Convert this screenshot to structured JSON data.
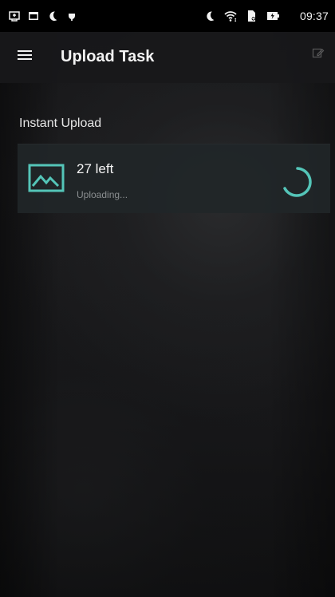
{
  "status_bar": {
    "time": "09:37",
    "left_icons": [
      "usb-icon",
      "calendar-icon",
      "moon-icon",
      "charging-plug-icon"
    ],
    "right_icons": [
      "moon-icon",
      "wifi-icon",
      "sim-icon",
      "battery-icon"
    ]
  },
  "header": {
    "title": "Upload Task",
    "menu_icon": "menu-icon",
    "edit_icon": "edit-icon"
  },
  "main": {
    "section_label": "Instant Upload",
    "task": {
      "title": "27 left",
      "status": "Uploading...",
      "icon": "image-icon",
      "spinner_icon": "loading-spinner-icon"
    }
  },
  "colors": {
    "accent": "#54c5b8",
    "status_bar": "#000000",
    "card": "#212628"
  }
}
